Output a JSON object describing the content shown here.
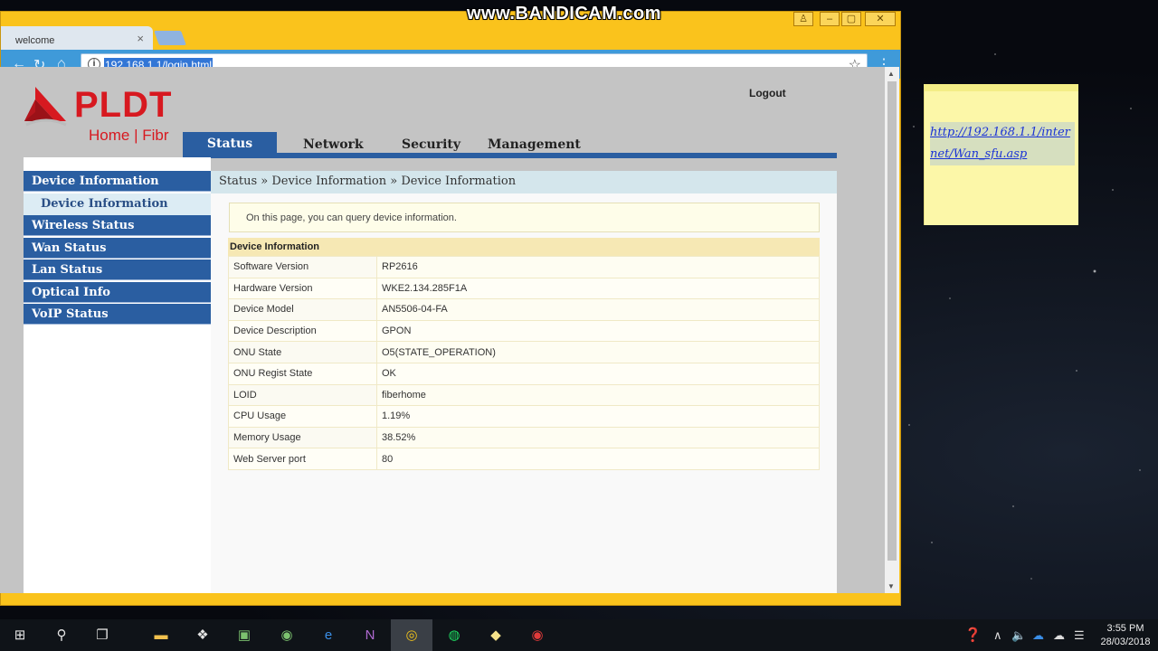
{
  "browser": {
    "tab_title": "welcome",
    "tab_close": "×",
    "url": "192.168.1.1/login.html",
    "watermark": "www.BANDICAM.com"
  },
  "header": {
    "logo_text": "PLDT",
    "logo_sub": "Home | Fibr",
    "logout_label": "Logout"
  },
  "nav": {
    "tabs": [
      {
        "label": "Status"
      },
      {
        "label": "Network"
      },
      {
        "label": "Security"
      },
      {
        "label": "Management"
      }
    ]
  },
  "sidebar": {
    "items": [
      {
        "label": "Device Information"
      },
      {
        "label": "Device Information"
      },
      {
        "label": "Wireless Status"
      },
      {
        "label": "Wan Status"
      },
      {
        "label": "Lan Status"
      },
      {
        "label": "Optical Info"
      },
      {
        "label": "VoIP Status"
      }
    ]
  },
  "main": {
    "breadcrumb": "Status » Device Information » Device Information",
    "notice": "On this page, you can query device information.",
    "section_title": "Device Information",
    "rows": [
      {
        "label": "Software Version",
        "value": "RP2616"
      },
      {
        "label": "Hardware Version",
        "value": "WKE2.134.285F1A"
      },
      {
        "label": "Device Model",
        "value": "AN5506-04-FA"
      },
      {
        "label": "Device Description",
        "value": "GPON"
      },
      {
        "label": "ONU State",
        "value": "O5(STATE_OPERATION)"
      },
      {
        "label": "ONU Regist State",
        "value": "OK"
      },
      {
        "label": "LOID",
        "value": "fiberhome"
      },
      {
        "label": "CPU Usage",
        "value": "1.19%"
      },
      {
        "label": "Memory Usage",
        "value": "38.52%"
      },
      {
        "label": "Web Server port",
        "value": "80"
      }
    ]
  },
  "sticky_note": {
    "text": "http://192.168.1.1/internet/Wan_sfu.asp"
  },
  "taskbar": {
    "time": "3:55 PM",
    "date": "28/03/2018"
  },
  "colors": {
    "nav_blue": "#2a5ea1",
    "brand_red": "#d71920",
    "window_frame": "#fac31c"
  }
}
